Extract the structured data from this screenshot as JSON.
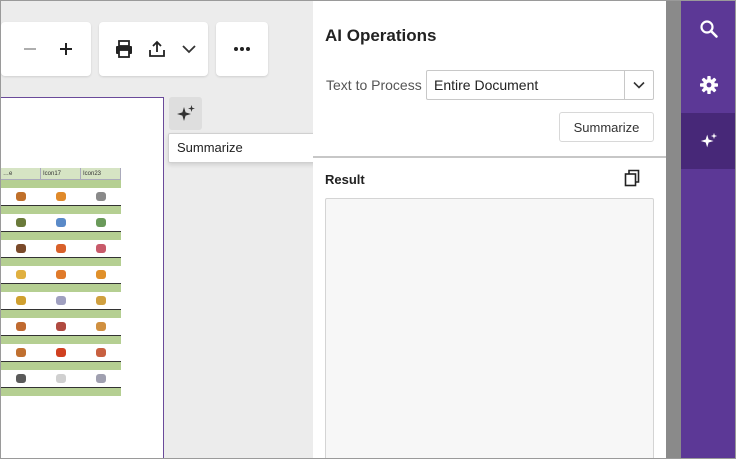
{
  "toolbar": {
    "zoom_out_icon": "minus-icon",
    "zoom_in_icon": "plus-icon",
    "print_icon": "printer-icon",
    "export_icon": "upload-icon",
    "export_dropdown_icon": "chevron-down-icon",
    "more_icon": "more-dots-icon"
  },
  "document": {
    "columns": [
      "…e",
      "Icon17",
      "Icon23"
    ],
    "row_count": 9
  },
  "ai_button": {
    "icon": "sparkle-icon"
  },
  "tooltip": {
    "text": "Summarize"
  },
  "panel": {
    "title": "AI Operations",
    "text_to_process_label": "Text to Process",
    "text_to_process_value": "Entire Document",
    "summarize_button": "Summarize",
    "result_label": "Result",
    "copy_icon": "copy-icon",
    "result_text": ""
  },
  "rail": {
    "items": [
      "search-icon",
      "gear-icon",
      "sparkle-icon"
    ],
    "active_index": 2
  },
  "colors": {
    "rail": "#5c3896",
    "rail_active": "#472878",
    "doc_border": "#6a4a9a",
    "table_header": "#d6e4c4",
    "table_separator": "#b5cf92"
  }
}
